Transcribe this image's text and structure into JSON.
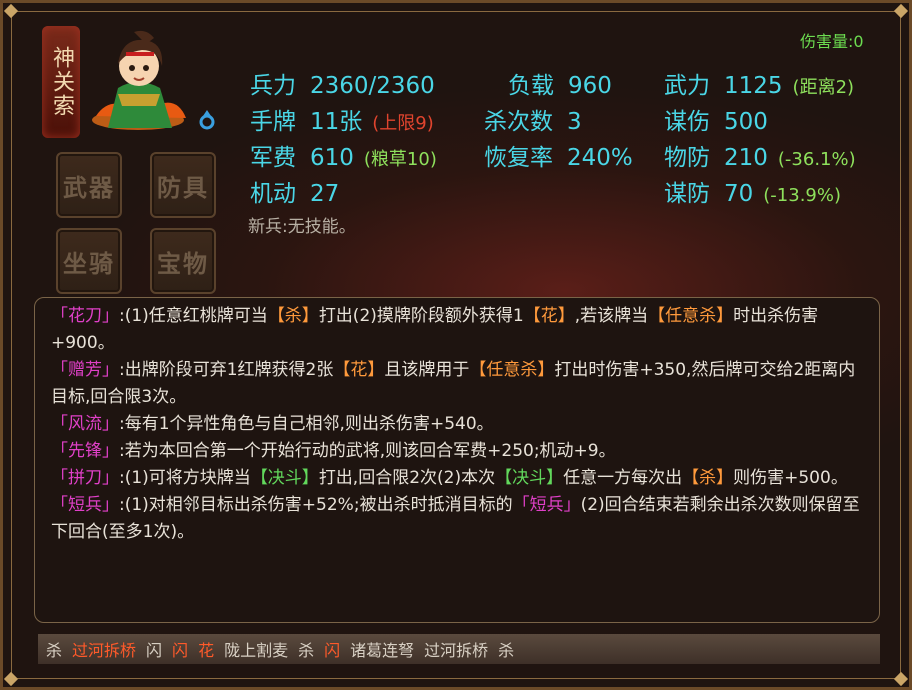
{
  "hero": {
    "name": "神关索",
    "damage_dealt": "伤害量:0",
    "passive": "新兵:无技能。"
  },
  "equipment_slots": [
    "武器",
    "防具",
    "坐骑",
    "宝物"
  ],
  "stats": {
    "troops": {
      "label": "兵力",
      "value": "2360/2360"
    },
    "load": {
      "label": "负载",
      "value": "960"
    },
    "force": {
      "label": "武力",
      "value": "1125",
      "note": "(距离2)"
    },
    "hand": {
      "label": "手牌",
      "value": "11张",
      "note": "(上限9)"
    },
    "kill_count": {
      "label": "杀次数",
      "value": "3"
    },
    "strategy_damage": {
      "label": "谋伤",
      "value": "500"
    },
    "military_fee": {
      "label": "军费",
      "value": "610",
      "note": "(粮草10)"
    },
    "recovery": {
      "label": "恢复率",
      "value": "240%"
    },
    "phys_def": {
      "label": "物防",
      "value": "210",
      "note": "(-36.1%)"
    },
    "mobility": {
      "label": "机动",
      "value": "27"
    },
    "strat_def": {
      "label": "谋防",
      "value": "70",
      "note": "(-13.9%)"
    }
  },
  "skills": [
    {
      "name": "「花刀」",
      "parts": [
        {
          "t": ":(1)任意红桃牌可当",
          "c": ""
        },
        {
          "t": "【杀】",
          "c": "orange"
        },
        {
          "t": "打出(2)摸牌阶段额外获得1",
          "c": ""
        },
        {
          "t": "【花】",
          "c": "orange"
        },
        {
          "t": ",若该牌当",
          "c": ""
        },
        {
          "t": "【任意杀】",
          "c": "orange"
        },
        {
          "t": "时出杀伤害+900。",
          "c": ""
        }
      ]
    },
    {
      "name": "「赠芳」",
      "parts": [
        {
          "t": ":出牌阶段可弃1红牌获得2张",
          "c": ""
        },
        {
          "t": "【花】",
          "c": "orange"
        },
        {
          "t": "且该牌用于",
          "c": ""
        },
        {
          "t": "【任意杀】",
          "c": "orange"
        },
        {
          "t": "打出时伤害+350,然后牌可交给2距离内目标,回合限3次。",
          "c": ""
        }
      ]
    },
    {
      "name": "「风流」",
      "parts": [
        {
          "t": ":每有1个异性角色与自己相邻,则出杀伤害+540。",
          "c": ""
        }
      ]
    },
    {
      "name": "「先锋」",
      "parts": [
        {
          "t": ":若为本回合第一个开始行动的武将,则该回合军费+250;机动+9。",
          "c": ""
        }
      ]
    },
    {
      "name": "「拼刀」",
      "parts": [
        {
          "t": ":(1)可将方块牌当",
          "c": ""
        },
        {
          "t": "【决斗】",
          "c": "green"
        },
        {
          "t": "打出,回合限2次(2)本次",
          "c": ""
        },
        {
          "t": "【决斗】",
          "c": "green"
        },
        {
          "t": "任意一方每次出",
          "c": ""
        },
        {
          "t": "【杀】",
          "c": "orange"
        },
        {
          "t": "则伤害+500。",
          "c": ""
        }
      ]
    },
    {
      "name": "「短兵」",
      "parts": [
        {
          "t": ":(1)对相邻目标出杀伤害+52%;被出杀时抵消目标的",
          "c": ""
        },
        {
          "t": "「短兵」",
          "c": "name"
        },
        {
          "t": "(2)回合结束若剩余出杀次数则保留至下回合(至多1次)。",
          "c": ""
        }
      ]
    }
  ],
  "deck": [
    {
      "name": "杀",
      "red": false
    },
    {
      "name": "过河拆桥",
      "red": true
    },
    {
      "name": "闪",
      "red": false
    },
    {
      "name": "闪",
      "red": true
    },
    {
      "name": "花",
      "red": true
    },
    {
      "name": "陇上割麦",
      "red": false
    },
    {
      "name": "杀",
      "red": false
    },
    {
      "name": "闪",
      "red": true
    },
    {
      "name": "诸葛连弩",
      "red": false
    },
    {
      "name": "过河拆桥",
      "red": false
    },
    {
      "name": "杀",
      "red": false
    }
  ],
  "colors": {
    "stat_cyan": "#4ad6e6",
    "skill_name_magenta": "#e040c8",
    "highlight_orange": "#ff9a3c",
    "highlight_green": "#62d85c",
    "damage_green": "#6cdc50",
    "card_red": "#ff5a2a"
  }
}
